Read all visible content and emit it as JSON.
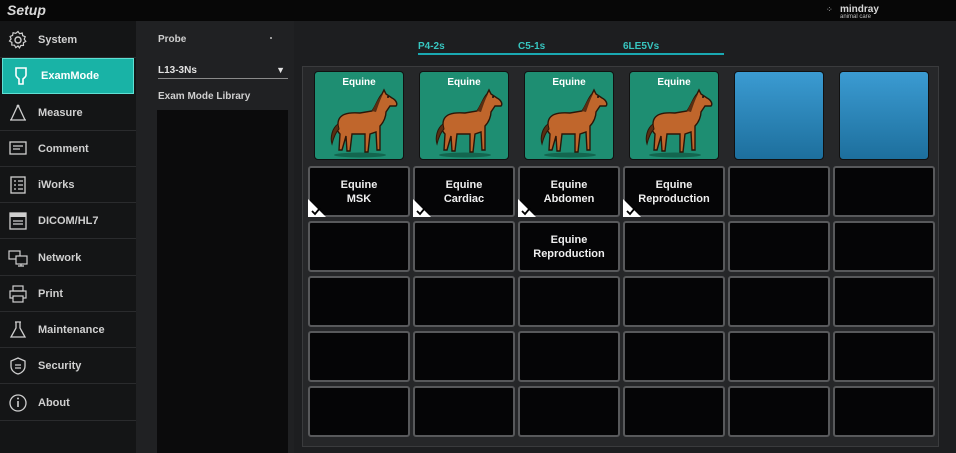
{
  "app": {
    "title": "Setup",
    "brand": {
      "name": "mindray",
      "sub": "animal care"
    }
  },
  "sidebar": {
    "items": [
      {
        "label": "System",
        "icon": "gear-icon",
        "active": false
      },
      {
        "label": "ExamMode",
        "icon": "probe-icon",
        "active": true
      },
      {
        "label": "Measure",
        "icon": "measure-icon",
        "active": false
      },
      {
        "label": "Comment",
        "icon": "comment-icon",
        "active": false
      },
      {
        "label": "iWorks",
        "icon": "iworks-icon",
        "active": false
      },
      {
        "label": "DICOM/HL7",
        "icon": "dicom-icon",
        "active": false
      },
      {
        "label": "Network",
        "icon": "network-icon",
        "active": false
      },
      {
        "label": "Print",
        "icon": "printer-icon",
        "active": false
      },
      {
        "label": "Maintenance",
        "icon": "maintenance-icon",
        "active": false
      },
      {
        "label": "Security",
        "icon": "shield-icon",
        "active": false
      },
      {
        "label": "About",
        "icon": "info-icon",
        "active": false
      }
    ]
  },
  "probe_panel": {
    "probe_label": "Probe",
    "probe_value": "L13-3Ns",
    "library_label": "Exam Mode Library"
  },
  "tabs": [
    "P4-2s",
    "C5-1s",
    "6LE5Vs"
  ],
  "image_row": [
    {
      "label": "Equine",
      "type": "equine"
    },
    {
      "label": "Equine",
      "type": "equine"
    },
    {
      "label": "Equine",
      "type": "equine"
    },
    {
      "label": "Equine",
      "type": "equine"
    },
    {
      "label": "",
      "type": "blank"
    },
    {
      "label": "",
      "type": "blank"
    }
  ],
  "grid": [
    [
      {
        "text": "Equine\nMSK",
        "checked": true
      },
      {
        "text": "Equine\nCardiac",
        "checked": true
      },
      {
        "text": "Equine\nAbdomen",
        "checked": true
      },
      {
        "text": "Equine\nReproduction",
        "checked": true
      },
      {
        "text": "",
        "checked": false
      },
      {
        "text": "",
        "checked": false
      }
    ],
    [
      {
        "text": "",
        "checked": false
      },
      {
        "text": "",
        "checked": false
      },
      {
        "text": "Equine\nReproduction",
        "checked": false
      },
      {
        "text": "",
        "checked": false
      },
      {
        "text": "",
        "checked": false
      },
      {
        "text": "",
        "checked": false
      }
    ],
    [
      {
        "text": "",
        "checked": false
      },
      {
        "text": "",
        "checked": false
      },
      {
        "text": "",
        "checked": false
      },
      {
        "text": "",
        "checked": false
      },
      {
        "text": "",
        "checked": false
      },
      {
        "text": "",
        "checked": false
      }
    ],
    [
      {
        "text": "",
        "checked": false
      },
      {
        "text": "",
        "checked": false
      },
      {
        "text": "",
        "checked": false
      },
      {
        "text": "",
        "checked": false
      },
      {
        "text": "",
        "checked": false
      },
      {
        "text": "",
        "checked": false
      }
    ],
    [
      {
        "text": "",
        "checked": false
      },
      {
        "text": "",
        "checked": false
      },
      {
        "text": "",
        "checked": false
      },
      {
        "text": "",
        "checked": false
      },
      {
        "text": "",
        "checked": false
      },
      {
        "text": "",
        "checked": false
      }
    ]
  ],
  "colors": {
    "accent": "#19b3a6",
    "tab_text": "#37c6c0",
    "equine_bg": "#1e8e72",
    "blank_tile": "#2b88bd"
  }
}
